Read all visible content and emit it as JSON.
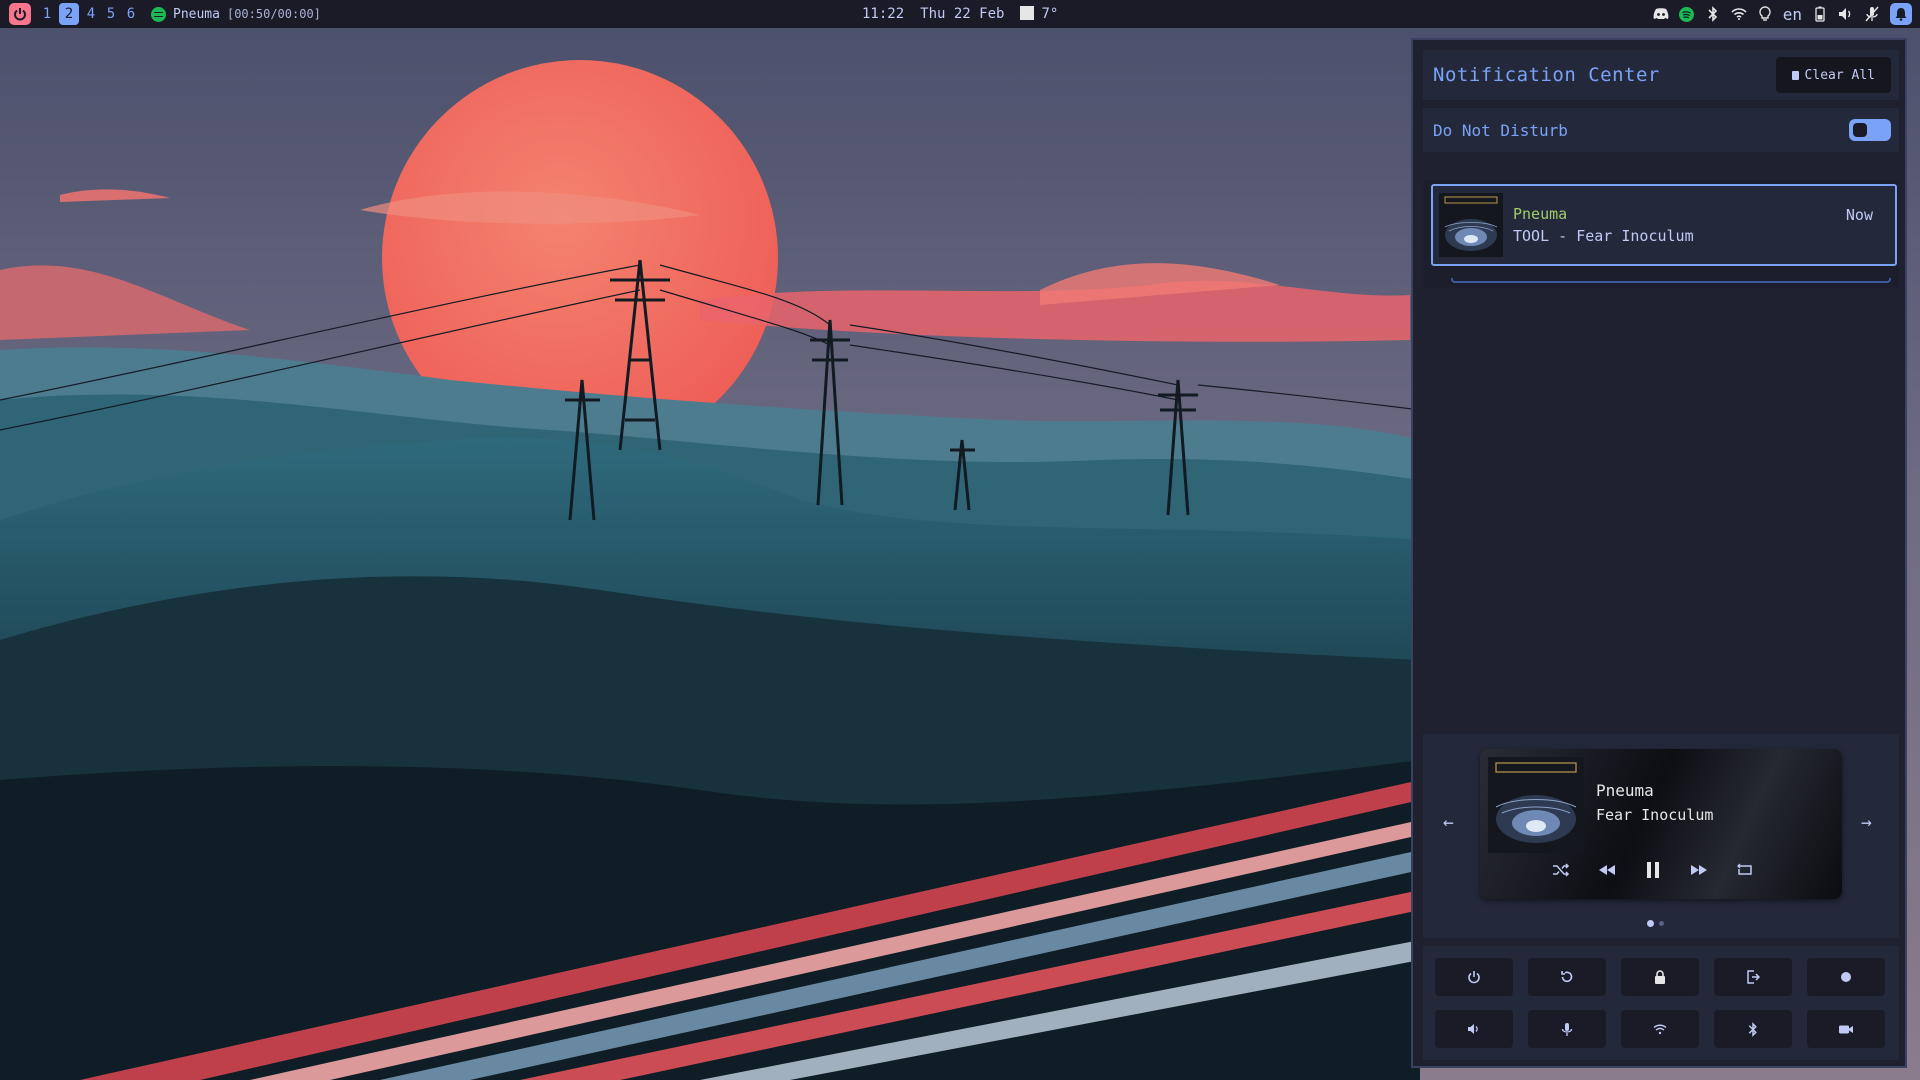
{
  "colors": {
    "bar_bg": "#1a1b26",
    "accent": "#7aa2f7",
    "notif_app": "#9ece6a",
    "power": "#f7768e",
    "panel_bg": "#1f2130"
  },
  "topbar": {
    "power_icon": "power-icon",
    "workspaces": [
      "1",
      "2",
      "4",
      "5",
      "6"
    ],
    "active_workspace": "2",
    "now_playing_icon": "spotify-icon",
    "now_playing_title": "Pneuma",
    "now_playing_time": "[00:50/00:00]",
    "clock": "11:22",
    "date": "Thu 22 Feb",
    "weather_icon": "cloud-icon",
    "temperature": "7°",
    "tray_icons": [
      "discord-icon",
      "spotify-icon",
      "bluetooth-icon",
      "wifi-icon",
      "bulb-icon"
    ],
    "language": "en",
    "tray_icons_right": [
      "battery-icon",
      "volume-icon",
      "mic-muted-icon",
      "bell-icon"
    ]
  },
  "notification_center": {
    "title": "Notification Center",
    "clear_all_label": "Clear All",
    "dnd_label": "Do Not Disturb",
    "dnd_on": true,
    "notifications": [
      {
        "app": "Pneuma",
        "body": "TOOL - Fear Inoculum",
        "time": "Now"
      }
    ],
    "player": {
      "title": "Pneuma",
      "artist": "Fear Inoculum",
      "controls": [
        "shuffle-icon",
        "previous-icon",
        "pause-icon",
        "next-icon",
        "repeat-icon"
      ],
      "pages": 2,
      "current_page": 1
    },
    "quick_settings": [
      "power-icon",
      "reboot-icon",
      "lock-icon",
      "logout-icon",
      "record-icon",
      "volume-icon",
      "mic-icon",
      "wifi-icon",
      "bluetooth-icon",
      "camera-icon"
    ]
  }
}
